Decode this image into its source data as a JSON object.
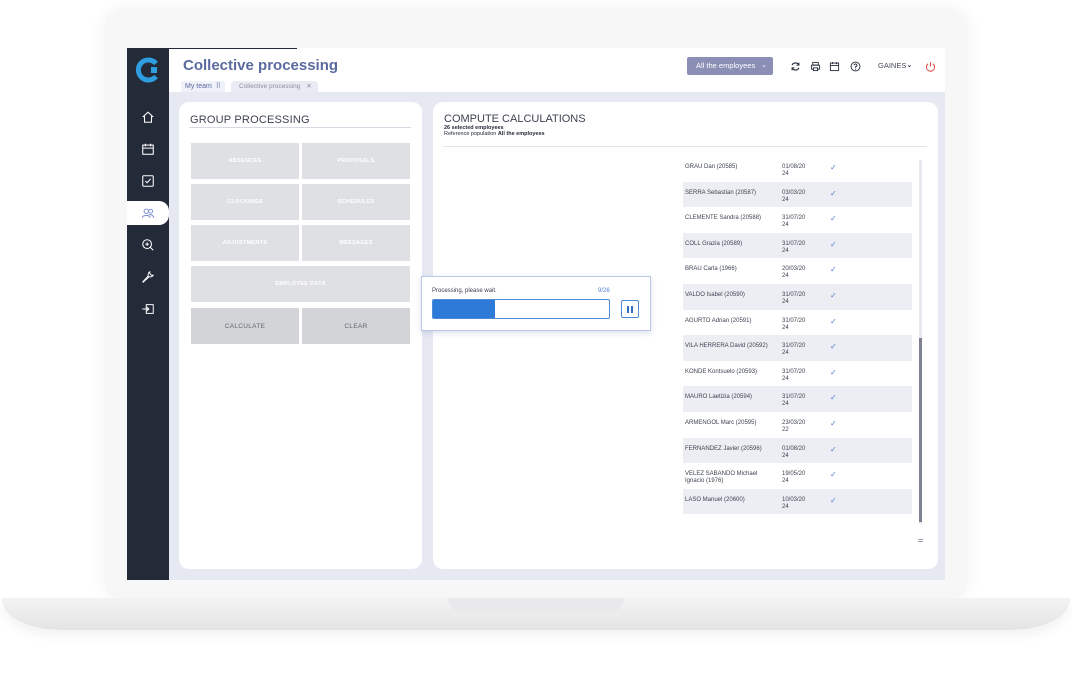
{
  "header": {
    "title": "Collective processing",
    "tabs": [
      {
        "label": "My team"
      },
      {
        "label": "Collective processing"
      }
    ],
    "employee_filter": "All the employees",
    "user": "GAINES"
  },
  "colors": {
    "sidebar": "#232a38",
    "accent": "#5b6a9f",
    "progress": "#2d7ad9",
    "check": "#4f7ed1",
    "power": "#e0473f"
  },
  "sidebar": {
    "icons": [
      "home-icon",
      "calendar-icon",
      "checkbox-icon",
      "team-icon",
      "search-plus-icon",
      "wrench-icon",
      "export-icon"
    ],
    "active": "team-icon"
  },
  "group_processing": {
    "title": "GROUP PROCESSING",
    "buttons": {
      "absences": "ABSENCES",
      "proposals": "PROPOSALS",
      "clockings": "CLOCKINGS",
      "schedules": "SCHEDULES",
      "adjustments": "ADJUSTMENTS",
      "messages": "MESSAGES",
      "employee_data": "EMPLOYEE DATA",
      "calculate": "CALCULATE",
      "clear": "CLEAR"
    }
  },
  "compute": {
    "title": "COMPUTE CALCULATIONS",
    "selected": "26 selected employees",
    "reference_label": "Reference population",
    "reference_value": "All the employees",
    "employees": [
      {
        "name": "GRAU Dan (20585)",
        "date": "01/08/20 24"
      },
      {
        "name": "SERRA Sebastian (20587)",
        "date": "03/03/20 24"
      },
      {
        "name": "CLEMENTE Sandra (20588)",
        "date": "31/07/20 24"
      },
      {
        "name": "COLL Grazia (20589)",
        "date": "31/07/20 24"
      },
      {
        "name": "BRAU Carla (1966)",
        "date": "20/03/20 24"
      },
      {
        "name": "VALDO Isabel (20590)",
        "date": "31/07/20 24"
      },
      {
        "name": "AGURTO Adrian (20591)",
        "date": "31/07/20 24"
      },
      {
        "name": "VILA HERRERA David (20592)",
        "date": "31/07/20 24"
      },
      {
        "name": "KONDE Kontsuelo (20593)",
        "date": "31/07/20 24"
      },
      {
        "name": "MAURO Laetizia (20594)",
        "date": "31/07/20 24"
      },
      {
        "name": "ARMENGOL Marc (20595)",
        "date": "23/03/20 22"
      },
      {
        "name": "FERNANDEZ Javier (20596)",
        "date": "01/08/20 24"
      },
      {
        "name": "VELEZ SABANDO Michael Ignacio (1976)",
        "date": "19/05/20 24"
      },
      {
        "name": "LASO Manuel (20600)",
        "date": "10/03/20 24"
      }
    ],
    "check_glyph": "✓"
  },
  "processing": {
    "text": "Processing, please wait.",
    "count": "9/26",
    "progress_fraction": 0.35
  }
}
